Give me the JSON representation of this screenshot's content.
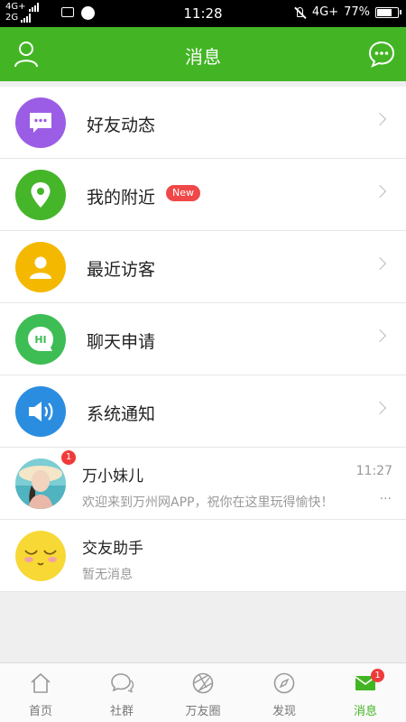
{
  "status_bar": {
    "network_top": "4G+",
    "network_bottom": "2G",
    "time": "11:28",
    "network_right": "4G+",
    "battery": "77%",
    "battery_level": 0.77
  },
  "header": {
    "title": "消息"
  },
  "menu": [
    {
      "label": "好友动态",
      "icon": "chat-bubble-icon",
      "color": "#9b5de5"
    },
    {
      "label": "我的附近",
      "icon": "location-pin-icon",
      "color": "#45b52a",
      "badge": "New"
    },
    {
      "label": "最近访客",
      "icon": "person-icon",
      "color": "#f5b800"
    },
    {
      "label": "聊天申请",
      "icon": "hi-bubble-icon",
      "color": "#3ebd55",
      "icon_text": "HI"
    },
    {
      "label": "系统通知",
      "icon": "speaker-icon",
      "color": "#2b8de0"
    }
  ],
  "chats": [
    {
      "name": "万小妹儿",
      "time": "11:27",
      "message": "欢迎来到万州网APP，祝你在这里玩得愉快！",
      "more": "···",
      "unread": "1"
    },
    {
      "name": "交友助手",
      "message": "暂无消息"
    }
  ],
  "bottom_nav": [
    {
      "label": "首页",
      "icon": "home-icon"
    },
    {
      "label": "社群",
      "icon": "chat-bubbles-icon"
    },
    {
      "label": "万友圈",
      "icon": "camera-shutter-icon"
    },
    {
      "label": "发现",
      "icon": "compass-icon"
    },
    {
      "label": "消息",
      "icon": "mail-icon",
      "badge": "1",
      "active": true
    }
  ],
  "colors": {
    "brand_green": "#43b524",
    "badge_red": "#f03a3a"
  }
}
